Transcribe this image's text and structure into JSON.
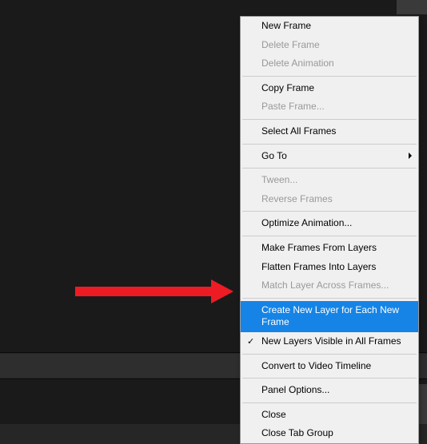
{
  "menu": {
    "items": [
      {
        "label": "New Frame",
        "enabled": true
      },
      {
        "label": "Delete Frame",
        "enabled": false
      },
      {
        "label": "Delete Animation",
        "enabled": false
      },
      {
        "separator": true
      },
      {
        "label": "Copy Frame",
        "enabled": true
      },
      {
        "label": "Paste Frame...",
        "enabled": false
      },
      {
        "separator": true
      },
      {
        "label": "Select All Frames",
        "enabled": true
      },
      {
        "separator": true
      },
      {
        "label": "Go To",
        "enabled": true,
        "submenu": true
      },
      {
        "separator": true
      },
      {
        "label": "Tween...",
        "enabled": false
      },
      {
        "label": "Reverse Frames",
        "enabled": false
      },
      {
        "separator": true
      },
      {
        "label": "Optimize Animation...",
        "enabled": true
      },
      {
        "separator": true
      },
      {
        "label": "Make Frames From Layers",
        "enabled": true
      },
      {
        "label": "Flatten Frames Into Layers",
        "enabled": true
      },
      {
        "label": "Match Layer Across Frames...",
        "enabled": false
      },
      {
        "separator": true
      },
      {
        "label": "Create New Layer for Each New Frame",
        "enabled": true,
        "selected": true
      },
      {
        "label": "New Layers Visible in All Frames",
        "enabled": true,
        "checked": true
      },
      {
        "separator": true
      },
      {
        "label": "Convert to Video Timeline",
        "enabled": true
      },
      {
        "separator": true
      },
      {
        "label": "Panel Options...",
        "enabled": true
      },
      {
        "separator": true
      },
      {
        "label": "Close",
        "enabled": true
      },
      {
        "label": "Close Tab Group",
        "enabled": true
      }
    ]
  }
}
